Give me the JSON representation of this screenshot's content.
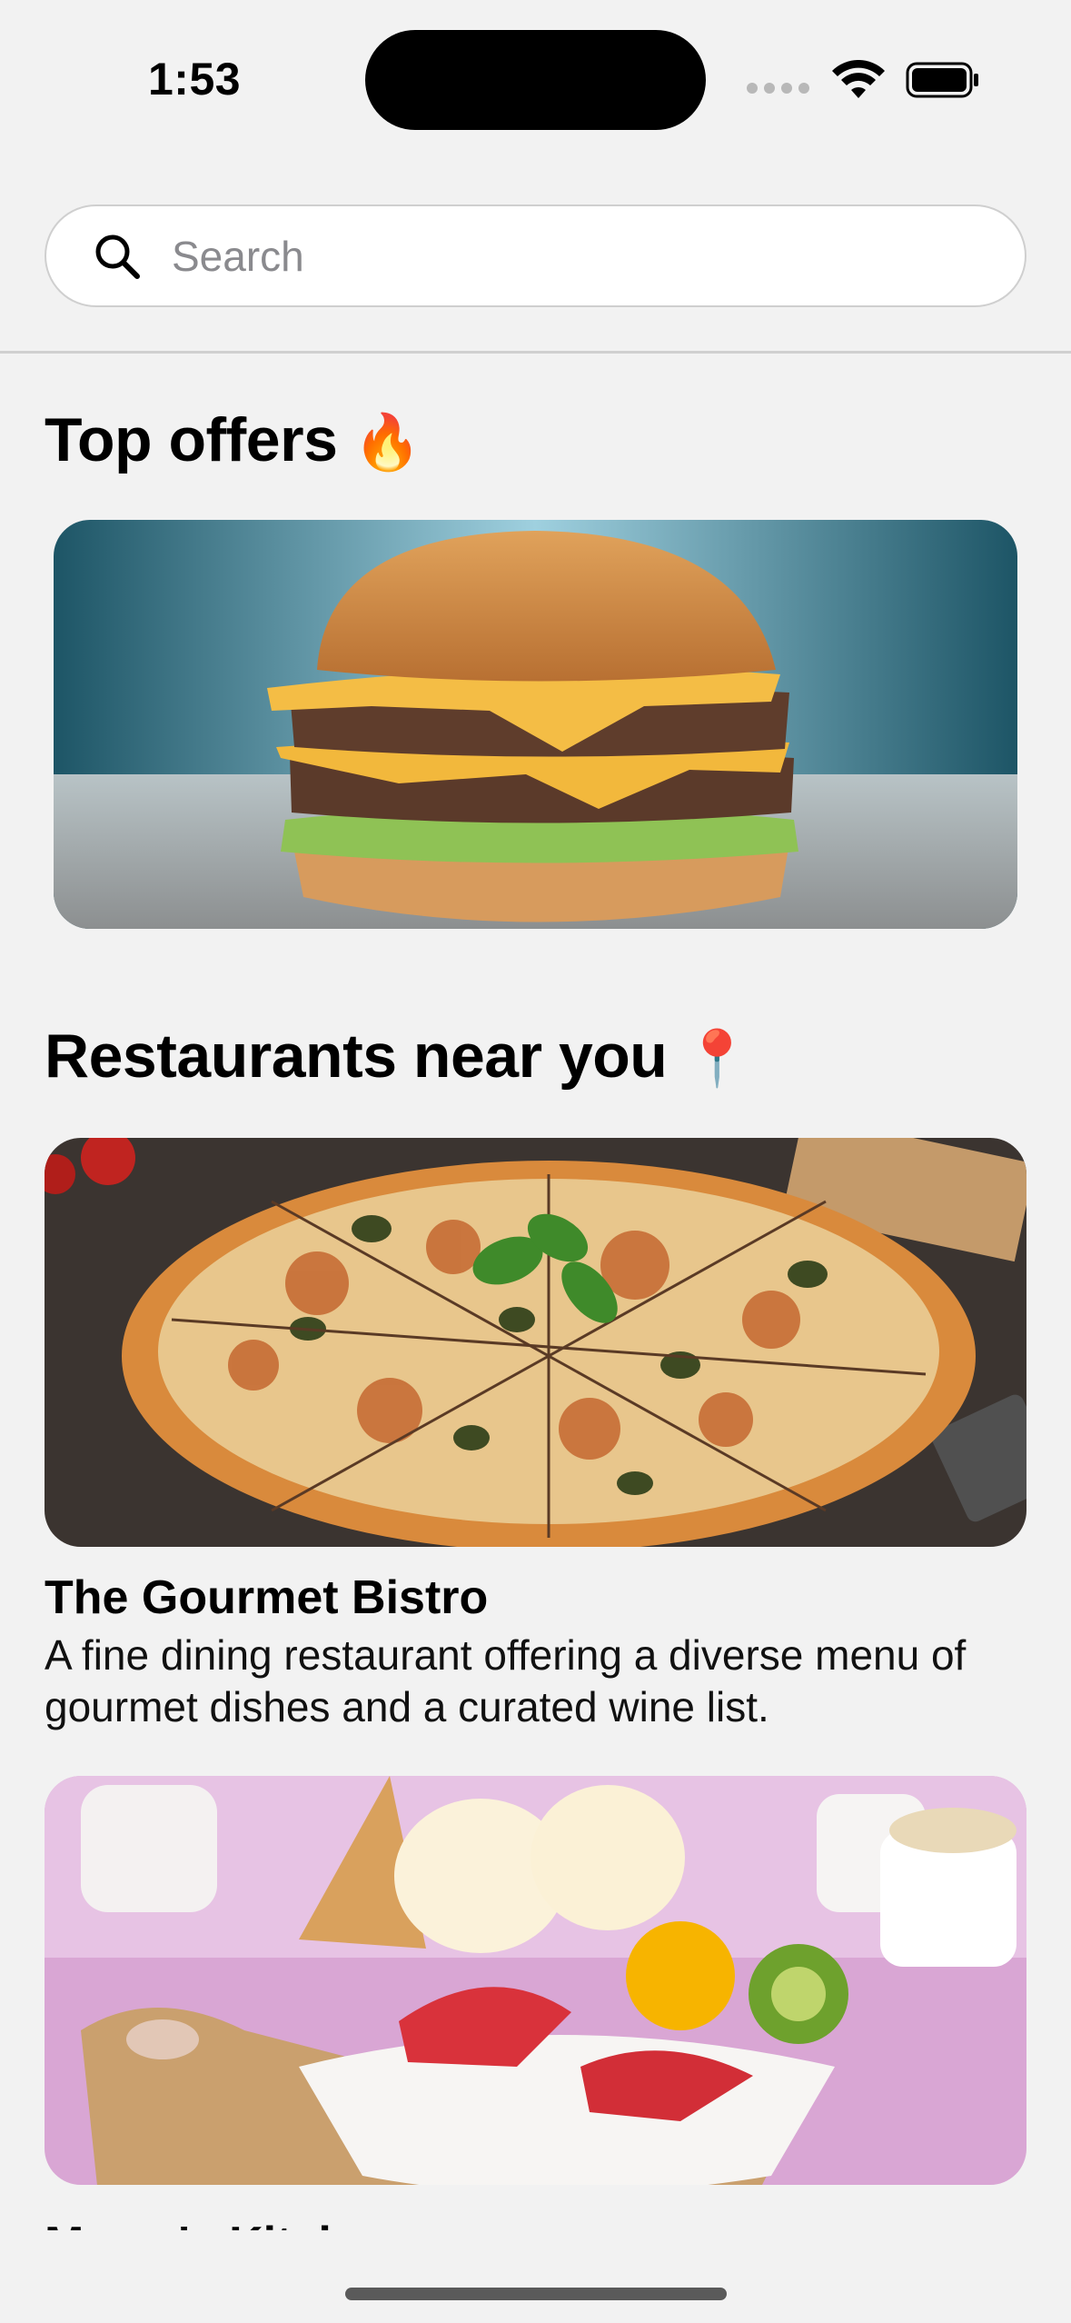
{
  "status_bar": {
    "time": "1:53"
  },
  "search": {
    "placeholder": "Search",
    "value": ""
  },
  "top_offers": {
    "title": "Top offers",
    "emoji": "🔥"
  },
  "restaurants": {
    "title": "Restaurants near you",
    "emoji": "📍",
    "items": [
      {
        "name": "The Gourmet Bistro",
        "description": "A fine dining restaurant offering a diverse menu of gourmet dishes and a curated wine list."
      },
      {
        "name": "Mama's Kitchen"
      }
    ]
  },
  "colors": {
    "background": "#f2f2f2",
    "search_background": "#ffffff",
    "placeholder": "#8a8a8e"
  }
}
